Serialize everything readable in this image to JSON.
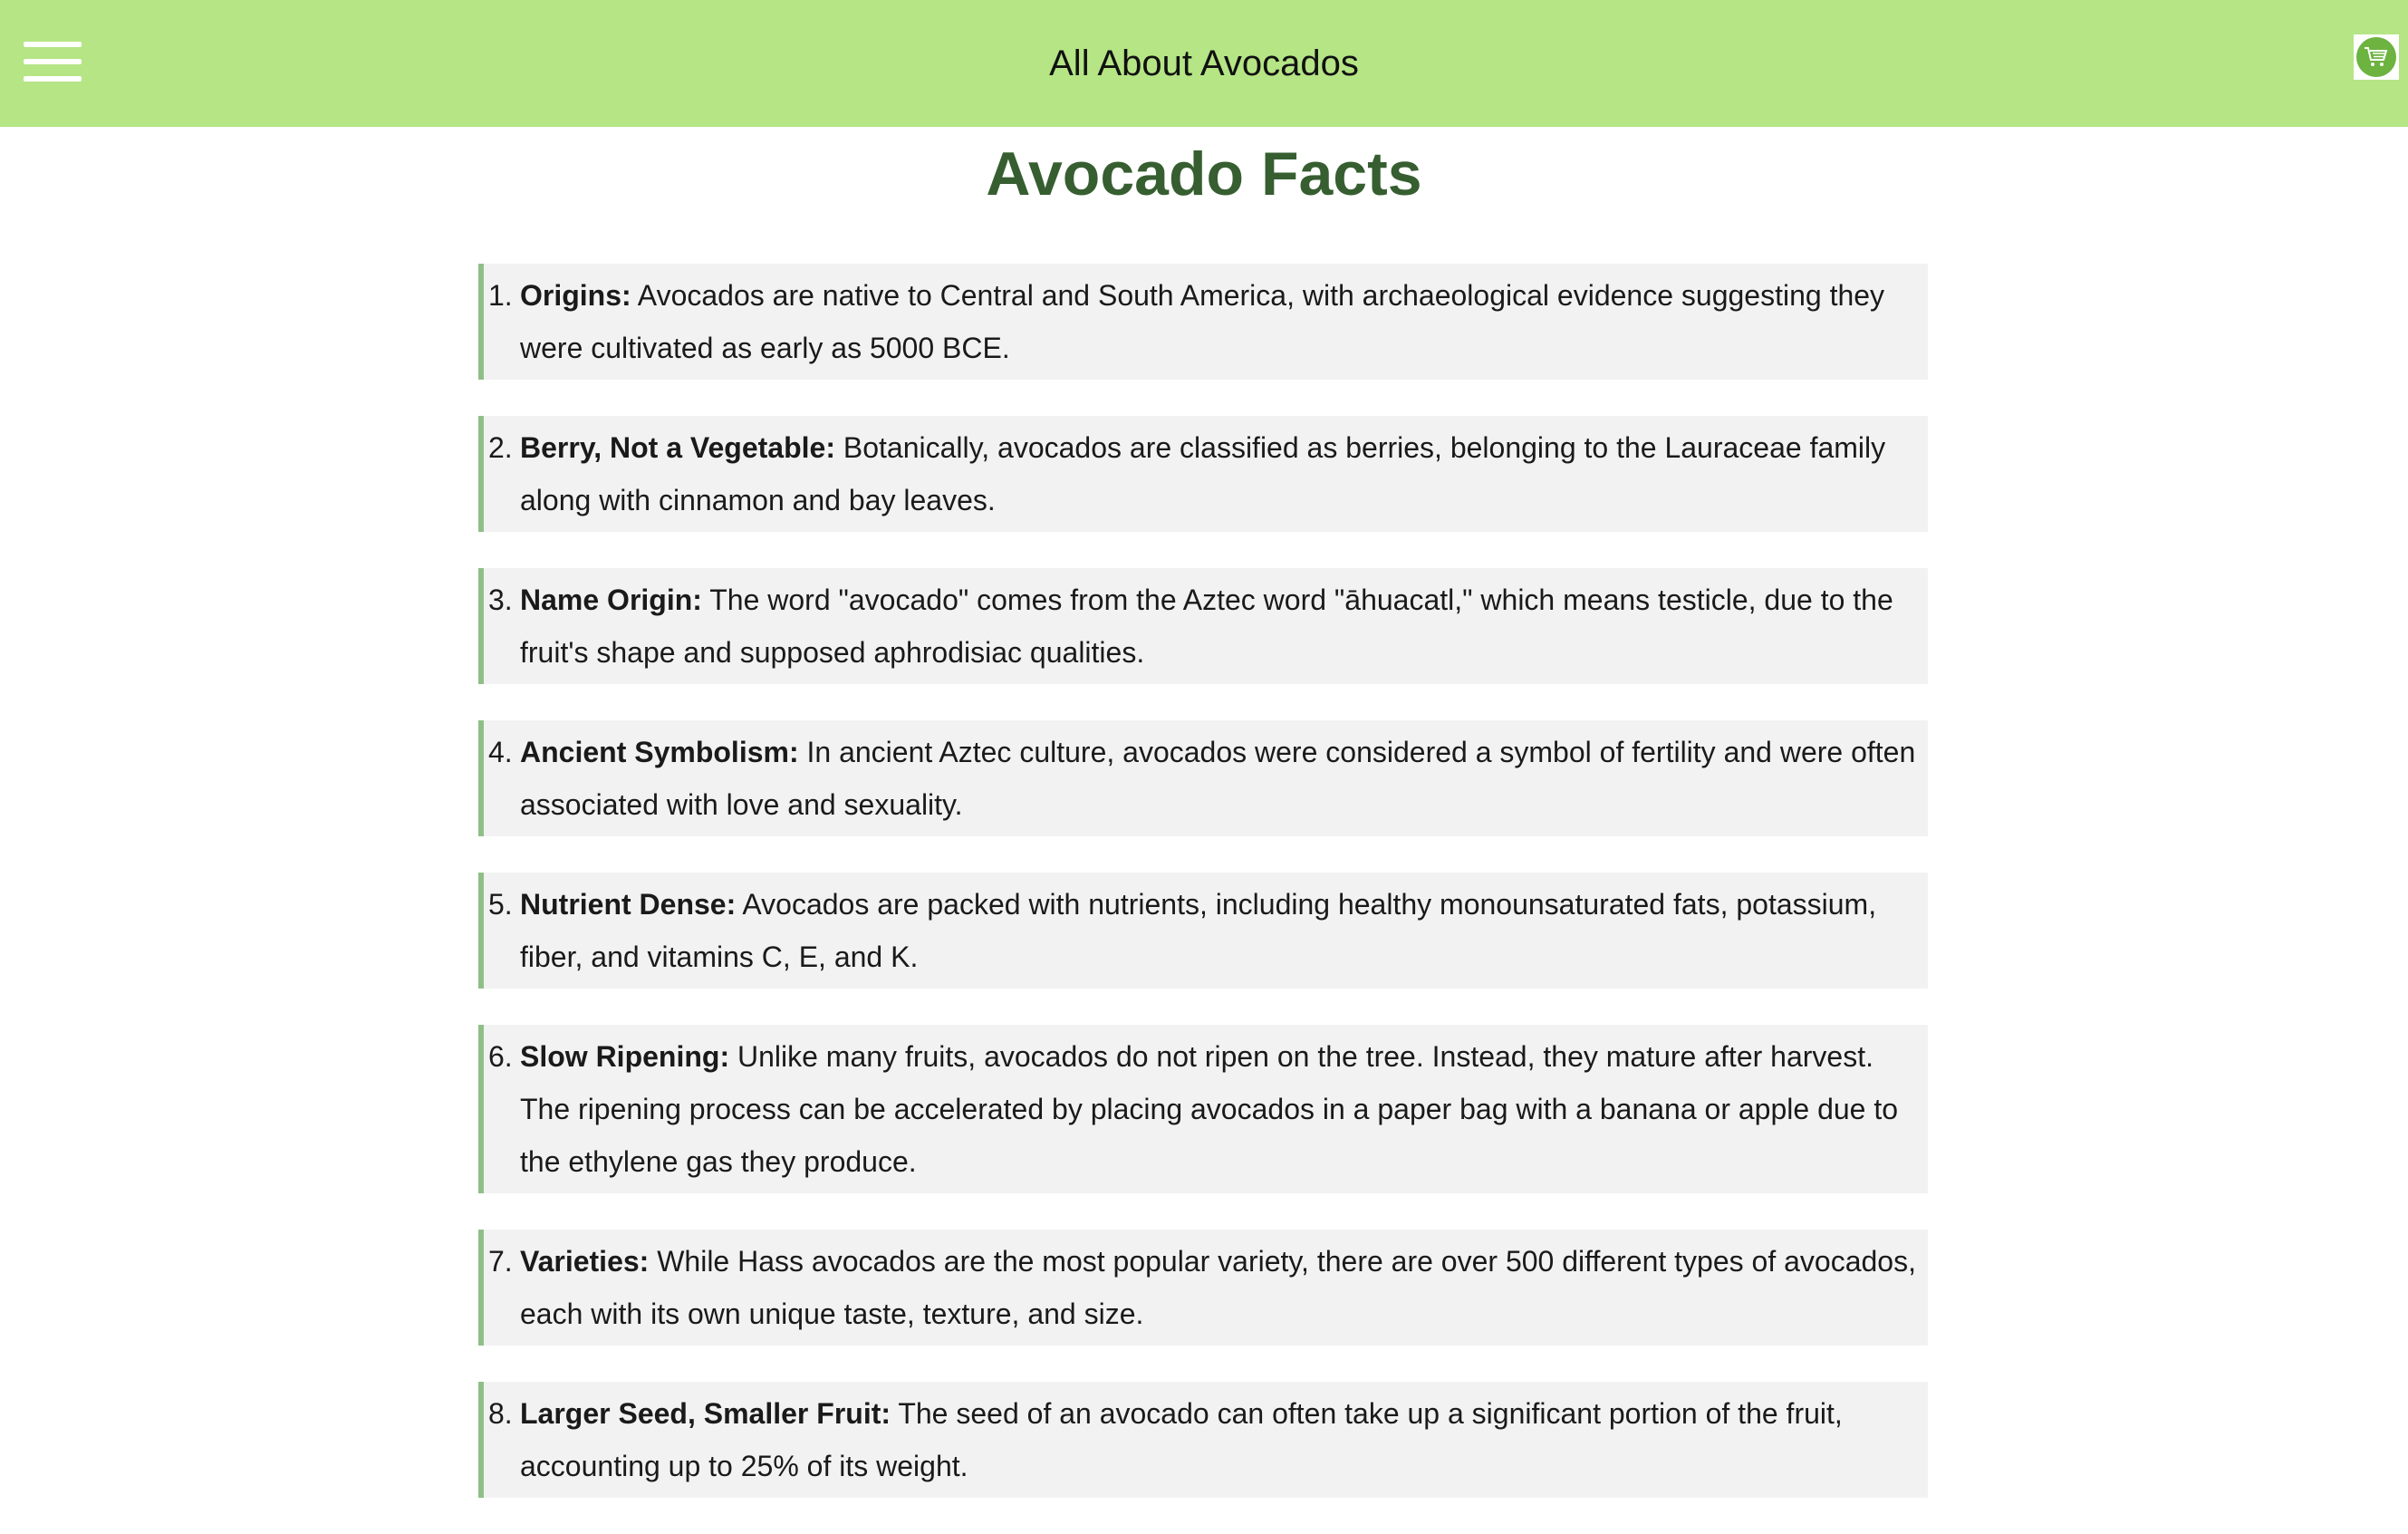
{
  "header": {
    "title": "All About Avocados",
    "menu_icon": "hamburger-menu-icon",
    "cart_icon": "shopping-cart-icon",
    "bg_color": "#b5e585"
  },
  "page": {
    "heading": "Avocado Facts",
    "heading_color": "#365e30"
  },
  "facts": [
    {
      "number": "1.",
      "term": "Origins:",
      "text": " Avocados are native to Central and South America, with archaeological evidence suggesting they were cultivated as early as 5000 BCE."
    },
    {
      "number": "2.",
      "term": "Berry, Not a Vegetable:",
      "text": " Botanically, avocados are classified as berries, belonging to the Lauraceae family along with cinnamon and bay leaves."
    },
    {
      "number": "3.",
      "term": "Name Origin:",
      "text": " The word \"avocado\" comes from the Aztec word \"āhuacatl,\" which means testicle, due to the fruit's shape and supposed aphrodisiac qualities."
    },
    {
      "number": "4.",
      "term": "Ancient Symbolism:",
      "text": " In ancient Aztec culture, avocados were considered a symbol of fertility and were often associated with love and sexuality."
    },
    {
      "number": "5.",
      "term": "Nutrient Dense:",
      "text": " Avocados are packed with nutrients, including healthy monounsaturated fats, potassium, fiber, and vitamins C, E, and K."
    },
    {
      "number": "6.",
      "term": "Slow Ripening:",
      "text": " Unlike many fruits, avocados do not ripen on the tree. Instead, they mature after harvest. The ripening process can be accelerated by placing avocados in a paper bag with a banana or apple due to the ethylene gas they produce."
    },
    {
      "number": "7.",
      "term": "Varieties:",
      "text": " While Hass avocados are the most popular variety, there are over 500 different types of avocados, each with its own unique taste, texture, and size."
    },
    {
      "number": "8.",
      "term": "Larger Seed, Smaller Fruit:",
      "text": " The seed of an avocado can often take up a significant portion of the fruit, accounting up to 25% of its weight."
    }
  ]
}
